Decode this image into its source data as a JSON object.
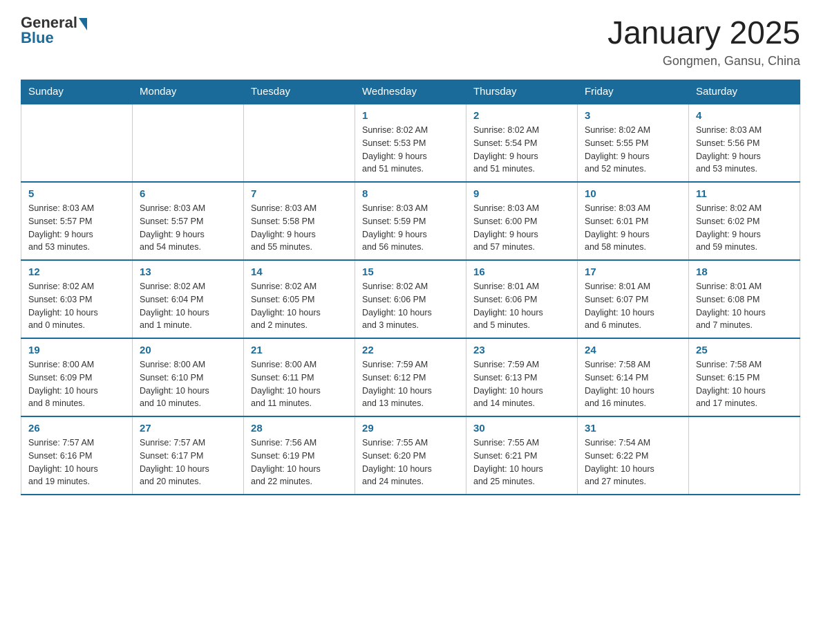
{
  "header": {
    "logo_general": "General",
    "logo_blue": "Blue",
    "month_title": "January 2025",
    "location": "Gongmen, Gansu, China"
  },
  "calendar": {
    "days_of_week": [
      "Sunday",
      "Monday",
      "Tuesday",
      "Wednesday",
      "Thursday",
      "Friday",
      "Saturday"
    ],
    "weeks": [
      [
        {
          "day": "",
          "info": ""
        },
        {
          "day": "",
          "info": ""
        },
        {
          "day": "",
          "info": ""
        },
        {
          "day": "1",
          "info": "Sunrise: 8:02 AM\nSunset: 5:53 PM\nDaylight: 9 hours\nand 51 minutes."
        },
        {
          "day": "2",
          "info": "Sunrise: 8:02 AM\nSunset: 5:54 PM\nDaylight: 9 hours\nand 51 minutes."
        },
        {
          "day": "3",
          "info": "Sunrise: 8:02 AM\nSunset: 5:55 PM\nDaylight: 9 hours\nand 52 minutes."
        },
        {
          "day": "4",
          "info": "Sunrise: 8:03 AM\nSunset: 5:56 PM\nDaylight: 9 hours\nand 53 minutes."
        }
      ],
      [
        {
          "day": "5",
          "info": "Sunrise: 8:03 AM\nSunset: 5:57 PM\nDaylight: 9 hours\nand 53 minutes."
        },
        {
          "day": "6",
          "info": "Sunrise: 8:03 AM\nSunset: 5:57 PM\nDaylight: 9 hours\nand 54 minutes."
        },
        {
          "day": "7",
          "info": "Sunrise: 8:03 AM\nSunset: 5:58 PM\nDaylight: 9 hours\nand 55 minutes."
        },
        {
          "day": "8",
          "info": "Sunrise: 8:03 AM\nSunset: 5:59 PM\nDaylight: 9 hours\nand 56 minutes."
        },
        {
          "day": "9",
          "info": "Sunrise: 8:03 AM\nSunset: 6:00 PM\nDaylight: 9 hours\nand 57 minutes."
        },
        {
          "day": "10",
          "info": "Sunrise: 8:03 AM\nSunset: 6:01 PM\nDaylight: 9 hours\nand 58 minutes."
        },
        {
          "day": "11",
          "info": "Sunrise: 8:02 AM\nSunset: 6:02 PM\nDaylight: 9 hours\nand 59 minutes."
        }
      ],
      [
        {
          "day": "12",
          "info": "Sunrise: 8:02 AM\nSunset: 6:03 PM\nDaylight: 10 hours\nand 0 minutes."
        },
        {
          "day": "13",
          "info": "Sunrise: 8:02 AM\nSunset: 6:04 PM\nDaylight: 10 hours\nand 1 minute."
        },
        {
          "day": "14",
          "info": "Sunrise: 8:02 AM\nSunset: 6:05 PM\nDaylight: 10 hours\nand 2 minutes."
        },
        {
          "day": "15",
          "info": "Sunrise: 8:02 AM\nSunset: 6:06 PM\nDaylight: 10 hours\nand 3 minutes."
        },
        {
          "day": "16",
          "info": "Sunrise: 8:01 AM\nSunset: 6:06 PM\nDaylight: 10 hours\nand 5 minutes."
        },
        {
          "day": "17",
          "info": "Sunrise: 8:01 AM\nSunset: 6:07 PM\nDaylight: 10 hours\nand 6 minutes."
        },
        {
          "day": "18",
          "info": "Sunrise: 8:01 AM\nSunset: 6:08 PM\nDaylight: 10 hours\nand 7 minutes."
        }
      ],
      [
        {
          "day": "19",
          "info": "Sunrise: 8:00 AM\nSunset: 6:09 PM\nDaylight: 10 hours\nand 8 minutes."
        },
        {
          "day": "20",
          "info": "Sunrise: 8:00 AM\nSunset: 6:10 PM\nDaylight: 10 hours\nand 10 minutes."
        },
        {
          "day": "21",
          "info": "Sunrise: 8:00 AM\nSunset: 6:11 PM\nDaylight: 10 hours\nand 11 minutes."
        },
        {
          "day": "22",
          "info": "Sunrise: 7:59 AM\nSunset: 6:12 PM\nDaylight: 10 hours\nand 13 minutes."
        },
        {
          "day": "23",
          "info": "Sunrise: 7:59 AM\nSunset: 6:13 PM\nDaylight: 10 hours\nand 14 minutes."
        },
        {
          "day": "24",
          "info": "Sunrise: 7:58 AM\nSunset: 6:14 PM\nDaylight: 10 hours\nand 16 minutes."
        },
        {
          "day": "25",
          "info": "Sunrise: 7:58 AM\nSunset: 6:15 PM\nDaylight: 10 hours\nand 17 minutes."
        }
      ],
      [
        {
          "day": "26",
          "info": "Sunrise: 7:57 AM\nSunset: 6:16 PM\nDaylight: 10 hours\nand 19 minutes."
        },
        {
          "day": "27",
          "info": "Sunrise: 7:57 AM\nSunset: 6:17 PM\nDaylight: 10 hours\nand 20 minutes."
        },
        {
          "day": "28",
          "info": "Sunrise: 7:56 AM\nSunset: 6:19 PM\nDaylight: 10 hours\nand 22 minutes."
        },
        {
          "day": "29",
          "info": "Sunrise: 7:55 AM\nSunset: 6:20 PM\nDaylight: 10 hours\nand 24 minutes."
        },
        {
          "day": "30",
          "info": "Sunrise: 7:55 AM\nSunset: 6:21 PM\nDaylight: 10 hours\nand 25 minutes."
        },
        {
          "day": "31",
          "info": "Sunrise: 7:54 AM\nSunset: 6:22 PM\nDaylight: 10 hours\nand 27 minutes."
        },
        {
          "day": "",
          "info": ""
        }
      ]
    ]
  }
}
